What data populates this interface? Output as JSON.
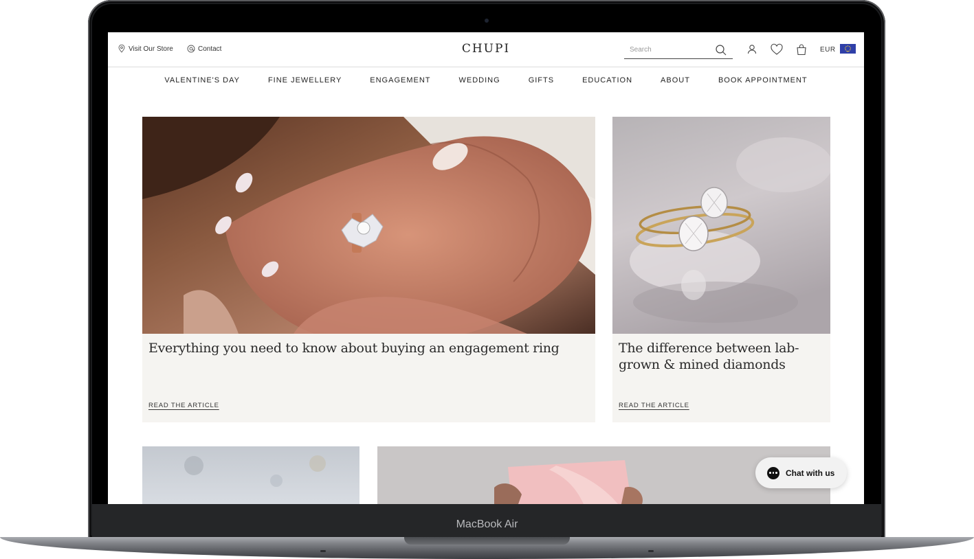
{
  "device": {
    "label": "MacBook Air"
  },
  "header": {
    "visit_store": "Visit Our Store",
    "contact": "Contact",
    "brand": "CHUPI",
    "search_placeholder": "Search",
    "currency": "EUR",
    "icons": [
      "location-pin-icon",
      "at-sign-icon",
      "search-icon",
      "account-icon",
      "heart-icon",
      "bag-icon",
      "eu-flag-icon"
    ]
  },
  "nav": {
    "items": [
      "VALENTINE'S DAY",
      "FINE JEWELLERY",
      "ENGAGEMENT",
      "WEDDING",
      "GIFTS",
      "EDUCATION",
      "ABOUT",
      "BOOK APPOINTMENT"
    ]
  },
  "articles": [
    {
      "title": "Everything you need to know about buying an engagement ring",
      "link": "READ THE ARTICLE"
    },
    {
      "title": "The difference between lab-\ngrown & mined diamonds",
      "link": "READ THE ARTICLE"
    }
  ],
  "chat": {
    "label": "Chat with us"
  },
  "colors": {
    "card_bg": "#f5f4f1",
    "text": "#222222",
    "frame": "#1b1c1e"
  }
}
